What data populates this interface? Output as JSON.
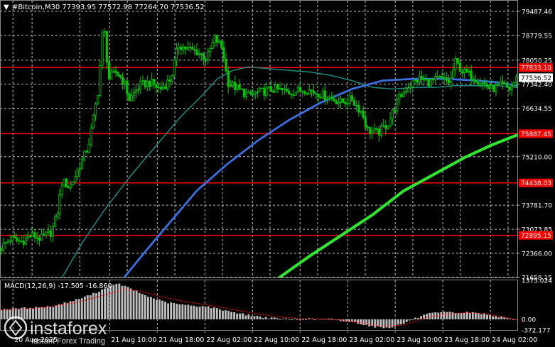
{
  "header": {
    "arrow": "▼",
    "text": "#Bitcoin,M30  77393.95 77572.98 77264.70 77536.52"
  },
  "macd_header": "MACD(12,26,9) -17.505 -16.860",
  "watermark": {
    "brand": "instaforex",
    "tagline": "Instant Forex Trading"
  },
  "colors": {
    "background": "#000000",
    "grid": "#ffffff",
    "candle": "#00c800",
    "level_line": "#ff0000",
    "ma_fast": "#1f8a7f",
    "ma_mid": "#3b6fe0",
    "ma_slow": "#2ee82e",
    "macd_hist": "#c0c0c0",
    "macd_signal": "#ff0000",
    "axis_text": "#ffffff"
  },
  "chart_data": {
    "type": "candlestick",
    "symbol": "#Bitcoin",
    "timeframe": "M30",
    "ohlc_last": {
      "open": 77393.95,
      "high": 77572.98,
      "low": 77264.7,
      "close": 77536.52
    },
    "ylim": [
      71655.15,
      79800
    ],
    "price_ticks": [
      {
        "value": 79487.46,
        "label": "79487.46"
      },
      {
        "value": 78779.55,
        "label": "78779.55"
      },
      {
        "value": 78050.25,
        "label": "78050.25"
      },
      {
        "value": 77342.4,
        "label": "77342.40"
      },
      {
        "value": 76634.55,
        "label": "76634.55"
      },
      {
        "value": 75210.0,
        "label": "75210.00"
      },
      {
        "value": 73781.7,
        "label": "73781.70"
      },
      {
        "value": 73073.85,
        "label": "73073.85"
      },
      {
        "value": 72366.0,
        "label": "72366.00"
      },
      {
        "value": 71658.15,
        "label": "71658.15"
      }
    ],
    "current_price": {
      "value": 77536.52,
      "label": "77536.52"
    },
    "levels": [
      {
        "value": 77833.1,
        "label": "77833.10"
      },
      {
        "value": 75887.45,
        "label": "75887.45"
      },
      {
        "value": 74438.03,
        "label": "74438.03"
      },
      {
        "value": 72895.15,
        "label": "72895.15"
      }
    ],
    "time_labels": [
      {
        "label": "20 Aug 2025",
        "pos": 0.025
      },
      {
        "label": "21 Aug 10:00",
        "pos": 0.212
      },
      {
        "label": "21 Aug 18:00",
        "pos": 0.304
      },
      {
        "label": "22 Aug 02:00",
        "pos": 0.396
      },
      {
        "label": "22 Aug 10:00",
        "pos": 0.488
      },
      {
        "label": "22 Aug 18:00",
        "pos": 0.58
      },
      {
        "label": "23 Aug 02:00",
        "pos": 0.672
      },
      {
        "label": "23 Aug 10:00",
        "pos": 0.764
      },
      {
        "label": "23 Aug 18:00",
        "pos": 0.856
      },
      {
        "label": "24 Aug 02:00",
        "pos": 0.948
      }
    ],
    "close_path": [
      [
        0.0,
        72500
      ],
      [
        0.02,
        72800
      ],
      [
        0.04,
        72700
      ],
      [
        0.06,
        72900
      ],
      [
        0.08,
        72800
      ],
      [
        0.1,
        73000
      ],
      [
        0.11,
        73500
      ],
      [
        0.12,
        74500
      ],
      [
        0.135,
        74300
      ],
      [
        0.15,
        74800
      ],
      [
        0.17,
        75500
      ],
      [
        0.18,
        76300
      ],
      [
        0.19,
        77200
      ],
      [
        0.2,
        79200
      ],
      [
        0.21,
        77500
      ],
      [
        0.225,
        77700
      ],
      [
        0.24,
        77400
      ],
      [
        0.25,
        76900
      ],
      [
        0.27,
        77300
      ],
      [
        0.29,
        77400
      ],
      [
        0.31,
        77200
      ],
      [
        0.33,
        77500
      ],
      [
        0.345,
        78500
      ],
      [
        0.36,
        78400
      ],
      [
        0.38,
        78300
      ],
      [
        0.4,
        78100
      ],
      [
        0.415,
        78700
      ],
      [
        0.43,
        78400
      ],
      [
        0.44,
        77400
      ],
      [
        0.46,
        77200
      ],
      [
        0.48,
        77000
      ],
      [
        0.5,
        77100
      ],
      [
        0.53,
        77200
      ],
      [
        0.56,
        77100
      ],
      [
        0.59,
        77200
      ],
      [
        0.61,
        77100
      ],
      [
        0.63,
        77000
      ],
      [
        0.66,
        76800
      ],
      [
        0.68,
        76900
      ],
      [
        0.7,
        76500
      ],
      [
        0.71,
        76000
      ],
      [
        0.73,
        75900
      ],
      [
        0.75,
        76200
      ],
      [
        0.77,
        76900
      ],
      [
        0.79,
        77300
      ],
      [
        0.81,
        77500
      ],
      [
        0.83,
        77400
      ],
      [
        0.85,
        77500
      ],
      [
        0.87,
        77400
      ],
      [
        0.88,
        78000
      ],
      [
        0.895,
        77700
      ],
      [
        0.91,
        77600
      ],
      [
        0.93,
        77400
      ],
      [
        0.95,
        77200
      ],
      [
        0.97,
        77300
      ],
      [
        0.985,
        77200
      ],
      [
        1.0,
        77536
      ]
    ],
    "ma_fast": [
      [
        0.12,
        71655
      ],
      [
        0.16,
        72700
      ],
      [
        0.2,
        73600
      ],
      [
        0.25,
        74600
      ],
      [
        0.3,
        75500
      ],
      [
        0.35,
        76400
      ],
      [
        0.39,
        77000
      ],
      [
        0.42,
        77500
      ],
      [
        0.45,
        77750
      ],
      [
        0.48,
        77850
      ],
      [
        0.52,
        77800
      ],
      [
        0.56,
        77750
      ],
      [
        0.6,
        77700
      ],
      [
        0.64,
        77600
      ],
      [
        0.68,
        77450
      ],
      [
        0.72,
        77250
      ],
      [
        0.76,
        77200
      ],
      [
        0.8,
        77250
      ],
      [
        0.84,
        77250
      ],
      [
        0.88,
        77300
      ],
      [
        0.92,
        77300
      ],
      [
        0.96,
        77300
      ],
      [
        1.0,
        77250
      ]
    ],
    "ma_mid": [
      [
        0.24,
        71655
      ],
      [
        0.28,
        72400
      ],
      [
        0.33,
        73300
      ],
      [
        0.38,
        74200
      ],
      [
        0.44,
        75000
      ],
      [
        0.5,
        75700
      ],
      [
        0.56,
        76300
      ],
      [
        0.62,
        76800
      ],
      [
        0.68,
        77200
      ],
      [
        0.74,
        77450
      ],
      [
        0.8,
        77500
      ],
      [
        0.86,
        77500
      ],
      [
        0.92,
        77450
      ],
      [
        0.96,
        77400
      ],
      [
        1.0,
        77300
      ]
    ],
    "ma_slow": [
      [
        0.54,
        71655
      ],
      [
        0.6,
        72300
      ],
      [
        0.66,
        72900
      ],
      [
        0.72,
        73500
      ],
      [
        0.78,
        74200
      ],
      [
        0.84,
        74700
      ],
      [
        0.9,
        75200
      ],
      [
        0.95,
        75550
      ],
      [
        1.0,
        75850
      ]
    ],
    "macd": {
      "name": "MACD(12,26,9)",
      "main": -17.505,
      "signal": -16.86,
      "ylim": [
        -372.177,
        1375.024
      ],
      "ticks": [
        {
          "value": 1375.024,
          "label": "1375.024"
        },
        {
          "value": 0.0,
          "label": "0.00"
        },
        {
          "value": -372.177,
          "label": "-372.177"
        }
      ],
      "hist_path": [
        [
          0.0,
          350
        ],
        [
          0.05,
          400
        ],
        [
          0.1,
          450
        ],
        [
          0.15,
          700
        ],
        [
          0.18,
          900
        ],
        [
          0.21,
          1150
        ],
        [
          0.23,
          1250
        ],
        [
          0.25,
          1100
        ],
        [
          0.28,
          850
        ],
        [
          0.32,
          600
        ],
        [
          0.36,
          500
        ],
        [
          0.4,
          450
        ],
        [
          0.44,
          300
        ],
        [
          0.48,
          150
        ],
        [
          0.52,
          50
        ],
        [
          0.56,
          0
        ],
        [
          0.6,
          20
        ],
        [
          0.64,
          10
        ],
        [
          0.66,
          -50
        ],
        [
          0.69,
          -120
        ],
        [
          0.72,
          -250
        ],
        [
          0.75,
          -300
        ],
        [
          0.78,
          -150
        ],
        [
          0.8,
          20
        ],
        [
          0.83,
          200
        ],
        [
          0.86,
          250
        ],
        [
          0.89,
          230
        ],
        [
          0.91,
          250
        ],
        [
          0.94,
          180
        ],
        [
          0.97,
          80
        ],
        [
          1.0,
          -17
        ]
      ],
      "signal_path": [
        [
          0.0,
          330
        ],
        [
          0.08,
          400
        ],
        [
          0.15,
          600
        ],
        [
          0.2,
          850
        ],
        [
          0.24,
          1050
        ],
        [
          0.27,
          1000
        ],
        [
          0.31,
          800
        ],
        [
          0.36,
          620
        ],
        [
          0.42,
          450
        ],
        [
          0.48,
          250
        ],
        [
          0.54,
          80
        ],
        [
          0.6,
          20
        ],
        [
          0.66,
          -20
        ],
        [
          0.7,
          -120
        ],
        [
          0.74,
          -240
        ],
        [
          0.78,
          -200
        ],
        [
          0.82,
          50
        ],
        [
          0.86,
          180
        ],
        [
          0.9,
          230
        ],
        [
          0.94,
          200
        ],
        [
          1.0,
          -17
        ]
      ]
    }
  }
}
